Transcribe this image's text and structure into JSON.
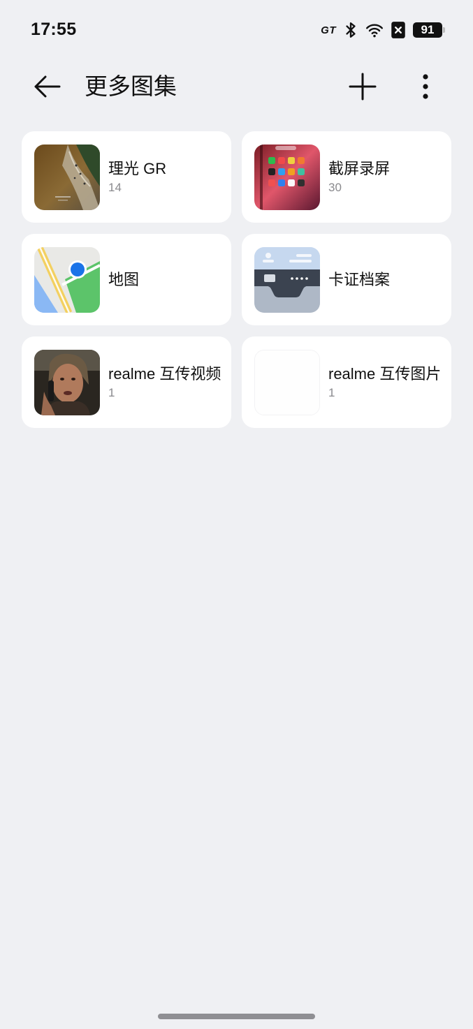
{
  "status_bar": {
    "time": "17:55",
    "network_label": "GT",
    "battery": "91"
  },
  "header": {
    "title": "更多图集",
    "back_icon": "arrow-left-icon",
    "add_icon": "plus-icon",
    "more_icon": "more-vertical-icon"
  },
  "albums": [
    {
      "name": "理光 GR",
      "count": "14",
      "thumb": "beach-aerial-photo"
    },
    {
      "name": "截屏录屏",
      "count": "30",
      "thumb": "phone-screenshot"
    },
    {
      "name": "地图",
      "count": "",
      "thumb": "map-icon"
    },
    {
      "name": "卡证档案",
      "count": "",
      "thumb": "card-wallet-icon"
    },
    {
      "name": "realme 互传视频",
      "count": "1",
      "thumb": "video-frame-person"
    },
    {
      "name": "realme 互传图片",
      "count": "1",
      "thumb": "blank-image"
    }
  ],
  "colors": {
    "background": "#eff0f3",
    "card": "#ffffff",
    "count_text": "#8a8a8e",
    "map_pin": "#1a73e8"
  }
}
